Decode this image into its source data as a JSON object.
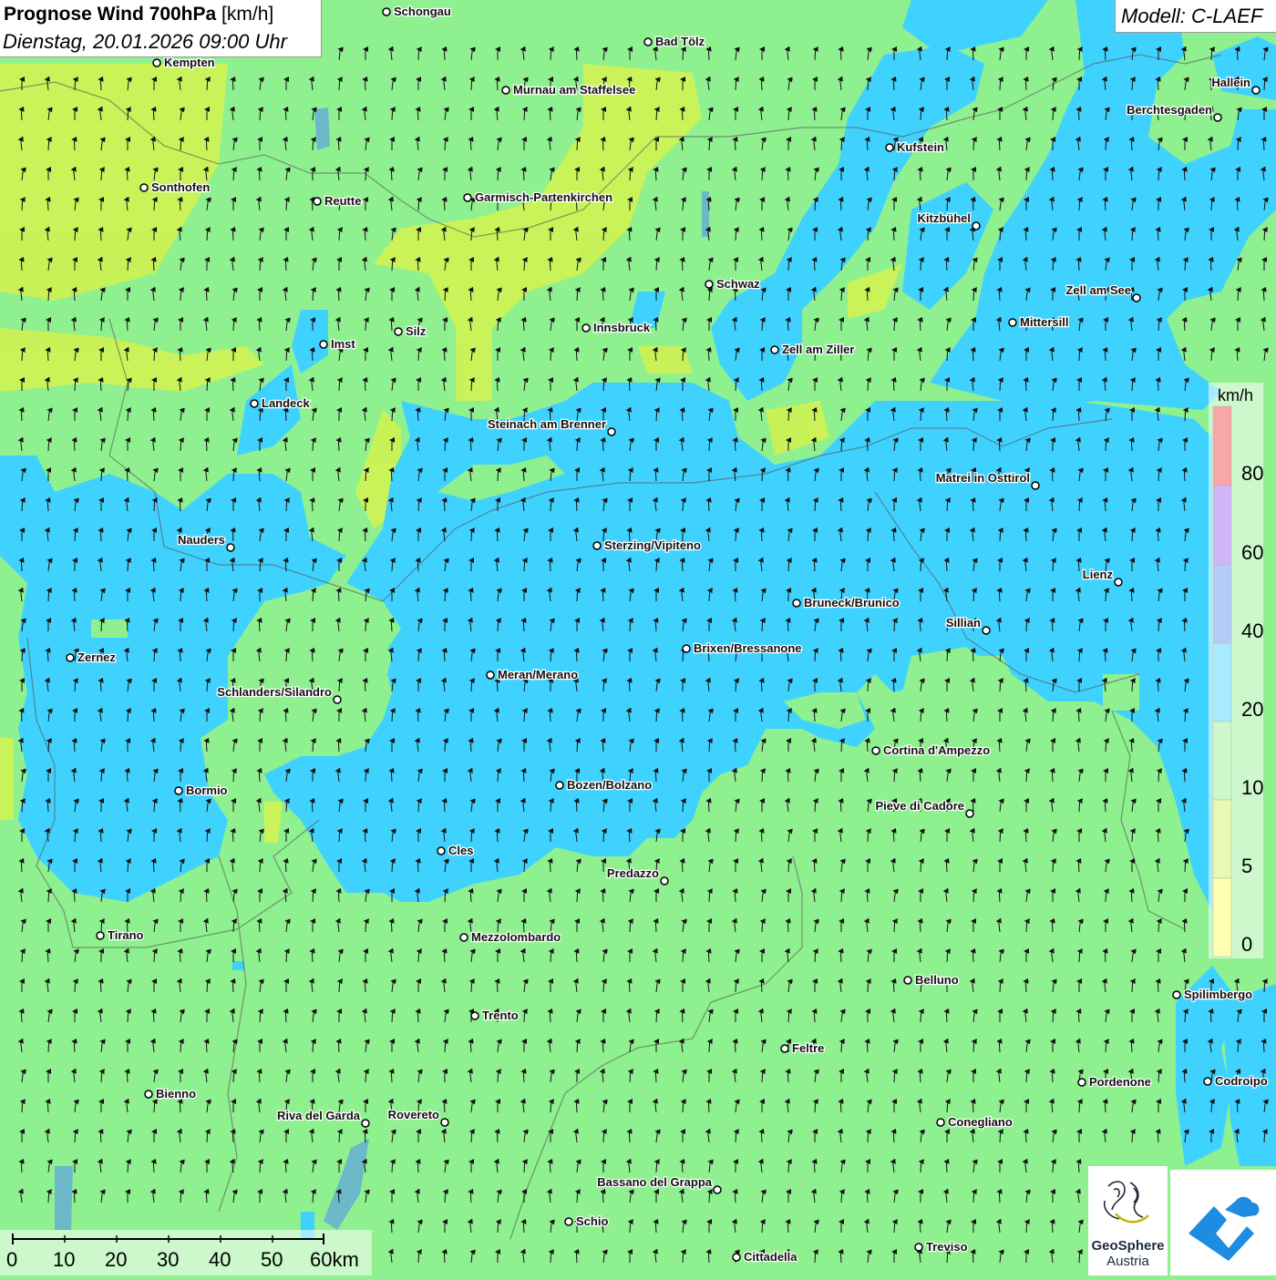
{
  "title": {
    "bold": "Prognose Wind 700hPa",
    "unit": " [km/h]",
    "date": "Dienstag, 20.01.2026 09:00 Uhr"
  },
  "model": "Modell: C-LAEF",
  "legend": {
    "unit": "km/h",
    "levels": [
      "80",
      "60",
      "40",
      "20",
      "10",
      "5",
      "0"
    ],
    "colors": {
      "0": "#ffff55",
      "5": "#ccf255",
      "10": "#8ff08f",
      "20": "#3fd2ff",
      "40": "#5b8cf0",
      "60": "#9b5cf0",
      "80": "#f03a3a"
    }
  },
  "scalebar": {
    "labels": [
      "0",
      "10",
      "20",
      "30",
      "40",
      "50",
      "60km"
    ]
  },
  "logos": {
    "geosphere_line1": "GeoSphere",
    "geosphere_line2": "Austria"
  },
  "wind": {
    "direction": "from south (arrows point north)",
    "dominant_range_kmh": "10-40"
  },
  "places": [
    "Schongau",
    "Bad Tölz",
    "Kempten",
    "Murnau am Staffelsee",
    "Hallein",
    "Berchtesgaden",
    "Kufstein",
    "Sonthofen",
    "Reutte",
    "Garmisch-Partenkirchen",
    "Kitzbühel",
    "Schwaz",
    "Zell am See",
    "Innsbruck",
    "Mittersill",
    "Imst",
    "Silz",
    "Zell am Ziller",
    "Landeck",
    "Steinach am Brenner",
    "Matrei in Osttirol",
    "Nauders",
    "Sterzing/Vipiteno",
    "Lienz",
    "Bruneck/Brunico",
    "Sillian",
    "Brixen/Bressanone",
    "Zernez",
    "Meran/Merano",
    "Schlanders/Silandro",
    "Cortina d'Ampezzo",
    "Bozen/Bolzano",
    "Bormio",
    "Pieve di Cadore",
    "Cles",
    "Predazzo",
    "Tirano",
    "Mezzolombardo",
    "Belluno",
    "Spilimbergo",
    "Trento",
    "Feltre",
    "Pordenone",
    "Codroipo",
    "Bienno",
    "Riva del Garda",
    "Rovereto",
    "Conegliano",
    "Bassano del Grappa",
    "Schio",
    "Treviso",
    "Cittadella"
  ]
}
